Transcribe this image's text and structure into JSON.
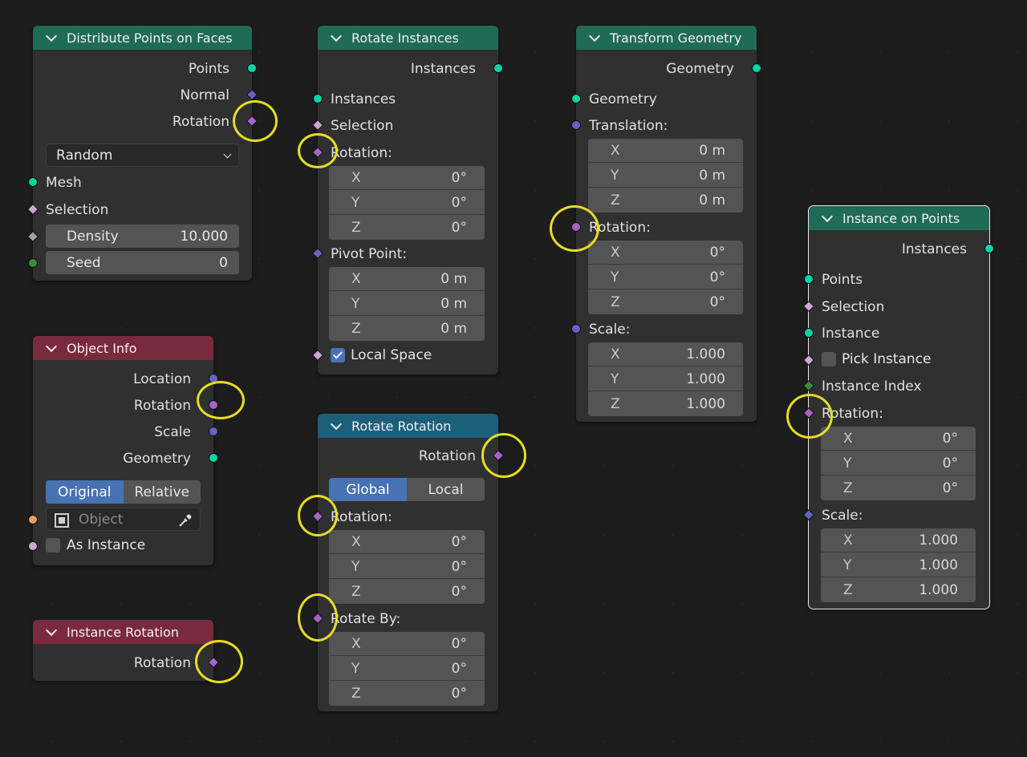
{
  "colors": {
    "geometry_socket": "#00d6a3",
    "vector_socket": "#6363c7",
    "rotation_socket": "#a663c7",
    "bool_socket": "#cca6d6",
    "float_socket": "#a1a1a1",
    "int_socket": "#3b8c3b",
    "object_socket": "#ed9e5c",
    "header_green": "#1f6b55",
    "header_red": "#7a2a3e",
    "header_blue": "#1d5f7a",
    "highlight_circle": "#e7dd22"
  },
  "distribute": {
    "title": "Distribute Points on Faces",
    "out_points": "Points",
    "out_normal": "Normal",
    "out_rotation": "Rotation",
    "mode": "Random",
    "in_mesh": "Mesh",
    "in_selection": "Selection",
    "density_label": "Density",
    "density_value": "10.000",
    "seed_label": "Seed",
    "seed_value": "0"
  },
  "object_info": {
    "title": "Object Info",
    "out_location": "Location",
    "out_rotation": "Rotation",
    "out_scale": "Scale",
    "out_geometry": "Geometry",
    "seg_original": "Original",
    "seg_relative": "Relative",
    "object_placeholder": "Object",
    "as_instance": "As Instance"
  },
  "instance_rotation": {
    "title": "Instance Rotation",
    "out_rotation": "Rotation"
  },
  "rotate_instances": {
    "title": "Rotate Instances",
    "out_instances": "Instances",
    "in_instances": "Instances",
    "in_selection": "Selection",
    "in_rotation": "Rotation:",
    "rot_x": "X",
    "rot_x_val": "0°",
    "rot_y": "Y",
    "rot_y_val": "0°",
    "rot_z": "Z",
    "rot_z_val": "0°",
    "in_pivot": "Pivot Point:",
    "piv_x": "X",
    "piv_x_val": "0 m",
    "piv_y": "Y",
    "piv_y_val": "0 m",
    "piv_z": "Z",
    "piv_z_val": "0 m",
    "local_space": "Local Space",
    "local_space_checked": true
  },
  "rotate_rotation": {
    "title": "Rotate Rotation",
    "out_rotation": "Rotation",
    "seg_global": "Global",
    "seg_local": "Local",
    "in_rotation": "Rotation:",
    "rot_x": "X",
    "rot_x_val": "0°",
    "rot_y": "Y",
    "rot_y_val": "0°",
    "rot_z": "Z",
    "rot_z_val": "0°",
    "in_rotate_by": "Rotate By:",
    "by_x": "X",
    "by_x_val": "0°",
    "by_y": "Y",
    "by_y_val": "0°",
    "by_z": "Z",
    "by_z_val": "0°"
  },
  "transform": {
    "title": "Transform Geometry",
    "out_geometry": "Geometry",
    "in_geometry": "Geometry",
    "in_translation": "Translation:",
    "tr_x": "X",
    "tr_x_val": "0 m",
    "tr_y": "Y",
    "tr_y_val": "0 m",
    "tr_z": "Z",
    "tr_z_val": "0 m",
    "in_rotation": "Rotation:",
    "rot_x": "X",
    "rot_x_val": "0°",
    "rot_y": "Y",
    "rot_y_val": "0°",
    "rot_z": "Z",
    "rot_z_val": "0°",
    "in_scale": "Scale:",
    "sc_x": "X",
    "sc_x_val": "1.000",
    "sc_y": "Y",
    "sc_y_val": "1.000",
    "sc_z": "Z",
    "sc_z_val": "1.000"
  },
  "instance_on_points": {
    "title": "Instance on Points",
    "out_instances": "Instances",
    "in_points": "Points",
    "in_selection": "Selection",
    "in_instance": "Instance",
    "in_pick_instance": "Pick Instance",
    "in_instance_index": "Instance Index",
    "in_rotation": "Rotation:",
    "rot_x": "X",
    "rot_x_val": "0°",
    "rot_y": "Y",
    "rot_y_val": "0°",
    "rot_z": "Z",
    "rot_z_val": "0°",
    "in_scale": "Scale:",
    "sc_x": "X",
    "sc_x_val": "1.000",
    "sc_y": "Y",
    "sc_y_val": "1.000",
    "sc_z": "Z",
    "sc_z_val": "1.000"
  }
}
